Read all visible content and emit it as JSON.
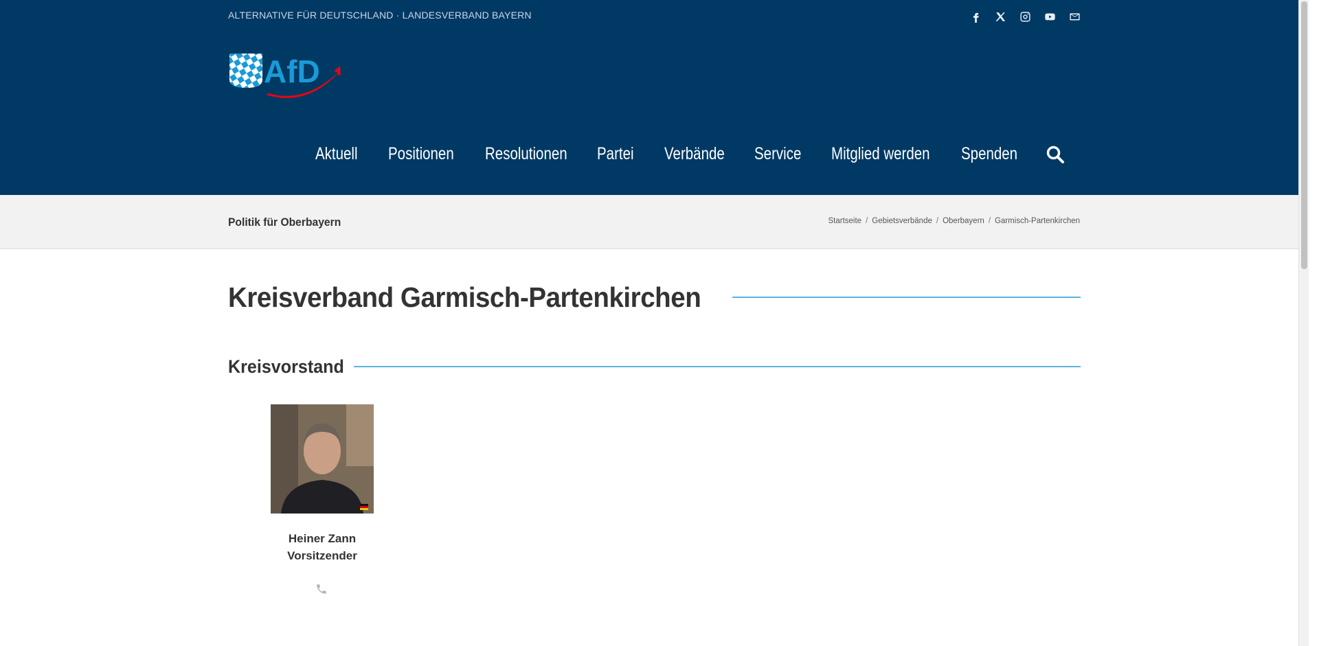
{
  "topbar": {
    "text": "ALTERNATIVE FÜR DEUTSCHLAND · LANDESVERBAND BAYERN",
    "social_icons": [
      "facebook-icon",
      "x-twitter-icon",
      "instagram-icon",
      "youtube-icon",
      "email-icon"
    ]
  },
  "logo": {
    "text": "AfD"
  },
  "nav": {
    "items": [
      "Aktuell",
      "Positionen",
      "Resolutionen",
      "Partei",
      "Verbände",
      "Service",
      "Mitglied werden",
      "Spenden"
    ],
    "search_icon": "search-icon"
  },
  "page_title_bar": {
    "title": "Politik für Oberbayern",
    "breadcrumb": [
      "Startseite",
      "Gebietsverbände",
      "Oberbayern",
      "Garmisch-Partenkirchen"
    ],
    "separator": "/"
  },
  "main": {
    "heading": "Kreisverband Garmisch-Partenkirchen",
    "section_heading": "Kreisvorstand",
    "members": [
      {
        "name": "Heiner Zann",
        "role": "Vorsitzender",
        "contact_icon": "phone-icon"
      }
    ]
  },
  "colors": {
    "header_bg": "#003964",
    "accent_line": "#5bb3df",
    "logo_blue": "#1a9ad6",
    "logo_red": "#e30613",
    "crumb_bg": "#f2f2f2"
  }
}
